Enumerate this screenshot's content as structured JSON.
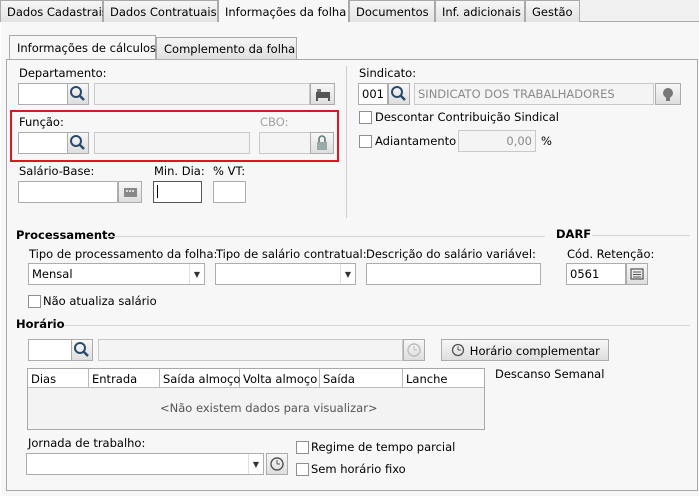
{
  "top_tabs": [
    "Dados Cadastrais",
    "Dados Contratuais",
    "Informações da folha",
    "Documentos",
    "Inf. adicionais",
    "Gestão"
  ],
  "sub_tabs": [
    "Informações de cálculos",
    "Complemento da folha"
  ],
  "departamento": {
    "label": "Departamento:"
  },
  "funcao": {
    "label": "Função:"
  },
  "cbo": {
    "label": "CBO:"
  },
  "salario_base": {
    "label": "Salário-Base:"
  },
  "min_dia": {
    "label": "Min. Dia:"
  },
  "vt": {
    "label": "% VT:"
  },
  "sindicato": {
    "label": "Sindicato:",
    "code": "001",
    "name": "SINDICATO DOS TRABALHADORES"
  },
  "descontar": {
    "label": "Descontar Contribuição Sindical"
  },
  "adiantamento": {
    "label": "Adiantamento",
    "value": "0,00",
    "unit": "%"
  },
  "processamento": {
    "title": "Processamento",
    "tipo_proc_label": "Tipo de processamento da folha:",
    "tipo_proc_value": "Mensal",
    "tipo_sal_label": "Tipo de salário contratual:",
    "desc_sal_label": "Descrição do salário variável:",
    "nao_atualiza": "Não atualiza salário"
  },
  "darf": {
    "title": "DARF",
    "label": "Cód. Retenção:",
    "value": "0561"
  },
  "horario": {
    "title": "Horário",
    "complementar_btn": "Horário complementar",
    "columns": [
      "Dias",
      "Entrada",
      "Saída almoço",
      "Volta almoço",
      "Saída",
      "Lanche"
    ],
    "empty": "<Não existem dados para visualizar>",
    "descanso": "Descanso Semanal",
    "jornada_label": "Jornada de trabalho:",
    "regime": "Regime de tempo parcial",
    "sem_fixo": "Sem horário fixo"
  },
  "colors": {
    "highlight": "#d9191f"
  }
}
